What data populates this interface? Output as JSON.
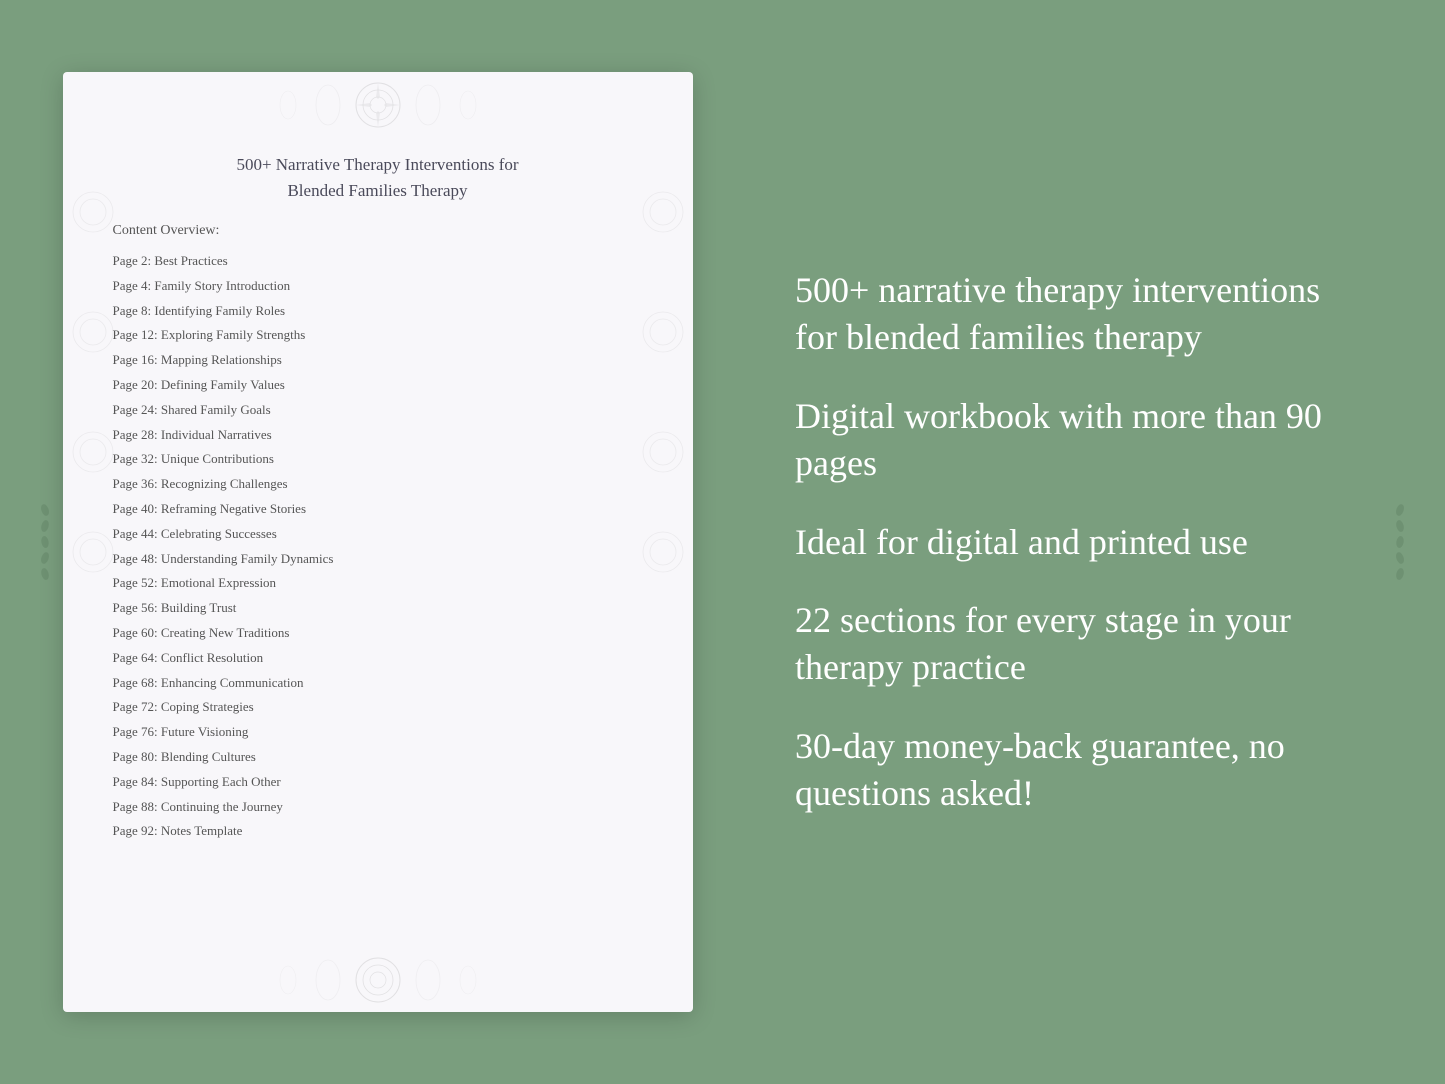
{
  "document": {
    "title_line1": "500+ Narrative Therapy Interventions for",
    "title_line2": "Blended Families Therapy",
    "content_overview_label": "Content Overview:",
    "toc_items": [
      {
        "page": "Page  2:",
        "title": "Best Practices"
      },
      {
        "page": "Page  4:",
        "title": "Family Story Introduction"
      },
      {
        "page": "Page  8:",
        "title": "Identifying Family Roles"
      },
      {
        "page": "Page 12:",
        "title": "Exploring Family Strengths"
      },
      {
        "page": "Page 16:",
        "title": "Mapping Relationships"
      },
      {
        "page": "Page 20:",
        "title": "Defining Family Values"
      },
      {
        "page": "Page 24:",
        "title": "Shared Family Goals"
      },
      {
        "page": "Page 28:",
        "title": "Individual Narratives"
      },
      {
        "page": "Page 32:",
        "title": "Unique Contributions"
      },
      {
        "page": "Page 36:",
        "title": "Recognizing Challenges"
      },
      {
        "page": "Page 40:",
        "title": "Reframing Negative Stories"
      },
      {
        "page": "Page 44:",
        "title": "Celebrating Successes"
      },
      {
        "page": "Page 48:",
        "title": "Understanding Family Dynamics"
      },
      {
        "page": "Page 52:",
        "title": "Emotional Expression"
      },
      {
        "page": "Page 56:",
        "title": "Building Trust"
      },
      {
        "page": "Page 60:",
        "title": "Creating New Traditions"
      },
      {
        "page": "Page 64:",
        "title": "Conflict Resolution"
      },
      {
        "page": "Page 68:",
        "title": "Enhancing Communication"
      },
      {
        "page": "Page 72:",
        "title": "Coping Strategies"
      },
      {
        "page": "Page 76:",
        "title": "Future Visioning"
      },
      {
        "page": "Page 80:",
        "title": "Blending Cultures"
      },
      {
        "page": "Page 84:",
        "title": "Supporting Each Other"
      },
      {
        "page": "Page 88:",
        "title": "Continuing the Journey"
      },
      {
        "page": "Page 92:",
        "title": "Notes Template"
      }
    ]
  },
  "features": [
    "500+ narrative therapy interventions for blended families therapy",
    "Digital workbook with more than 90 pages",
    "Ideal for digital and printed use",
    "22 sections for every stage in your therapy practice",
    "30-day money-back guarantee, no questions asked!"
  ]
}
